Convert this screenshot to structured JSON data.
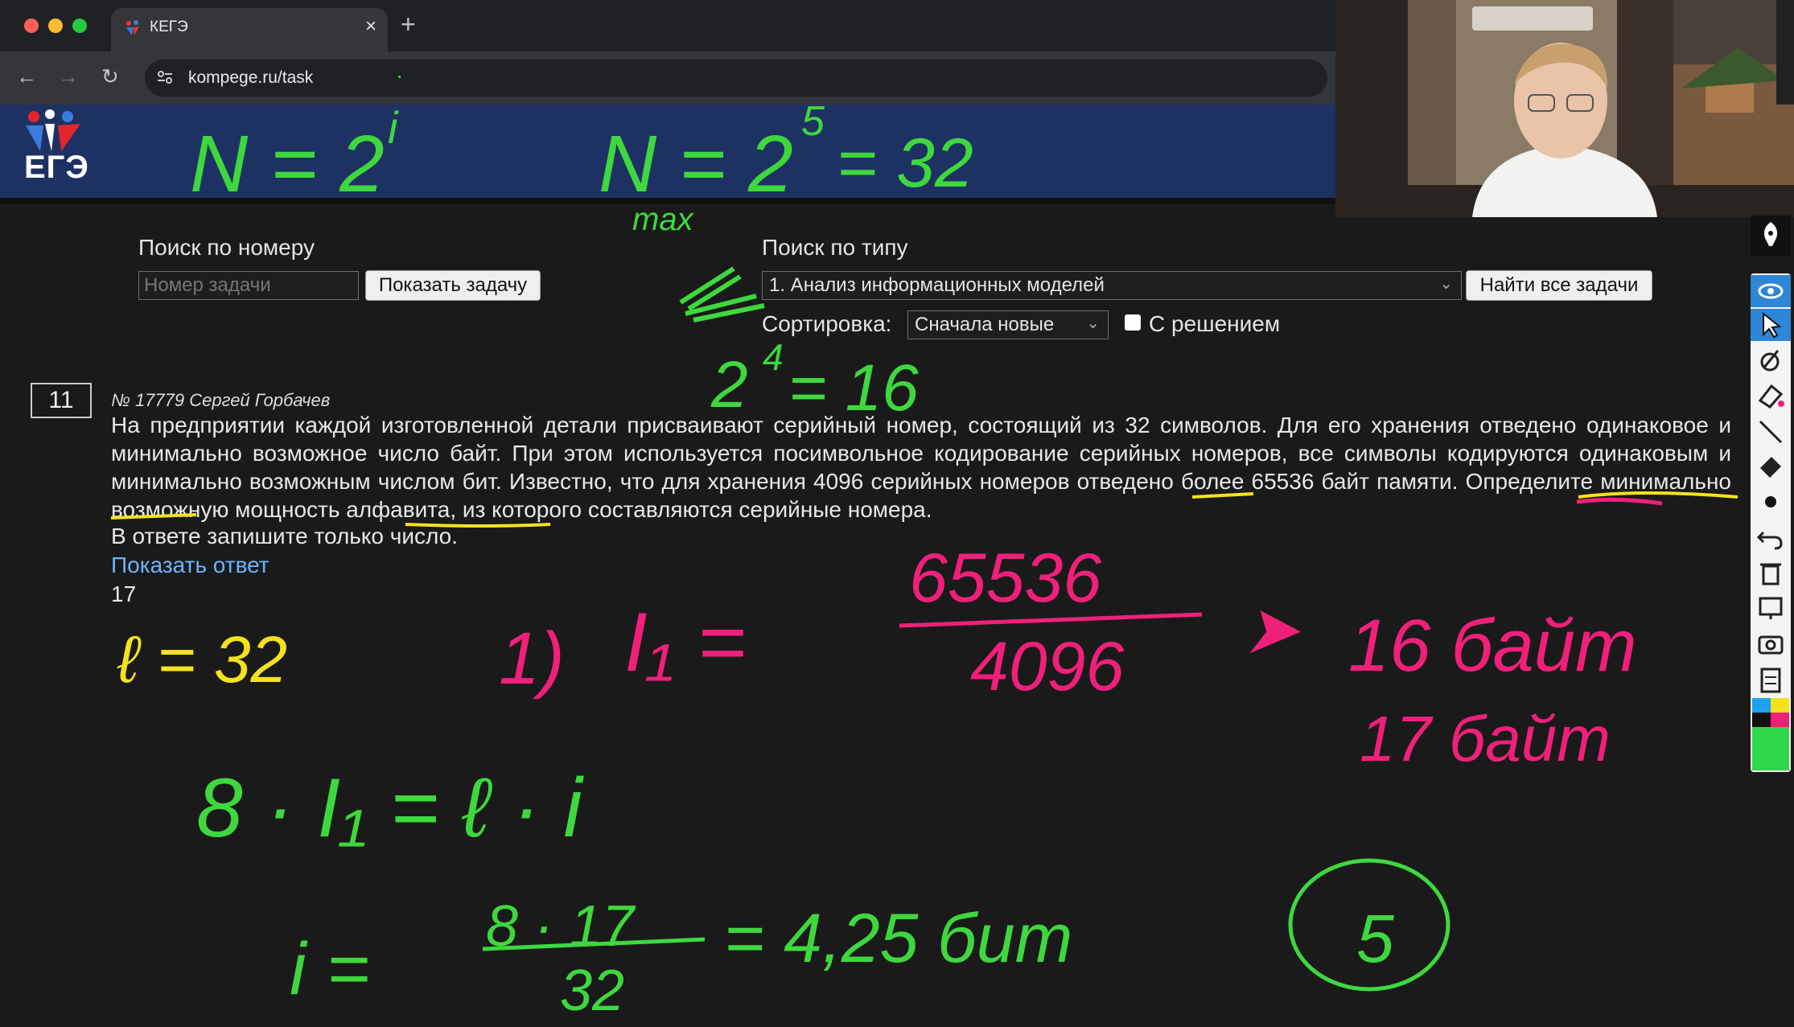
{
  "browser": {
    "tab_title": "КЕГЭ",
    "tab_close": "×",
    "new_tab": "+",
    "back": "←",
    "forward": "→",
    "reload": "↻",
    "url": "kompege.ru/task",
    "url_dot": "·"
  },
  "site": {
    "logo_text": "ЕГЭ"
  },
  "search_by_number": {
    "label": "Поиск по номеру",
    "placeholder": "Номер задачи",
    "button": "Показать задачу"
  },
  "search_by_type": {
    "label": "Поиск по типу",
    "selected_type": "1. Анализ информационных моделей",
    "button": "Найти все задачи",
    "sort_label": "Сортировка:",
    "sort_value": "Сначала новые",
    "solution_checkbox_label": "С решением",
    "solution_checked": false
  },
  "task": {
    "number": "11",
    "meta": "№ 17779 Сергей Горбачев",
    "text": "На предприятии каждой изготовленной детали присваивают серийный номер, состоящий из 32 символов. Для его хранения отведено одинаковое и минимально возможное число байт. При этом используется посимвольное кодирование серийных номеров, все символы кодируются одинаковым и минимально возможным числом бит. Известно, что для хранения 4096 серийных номеров отведено более 65536 байт памяти. Определите минимально возможную мощность алфавита, из которого составляются серийные номера.",
    "instruction": "В ответе запишите только число.",
    "show_answer": "Показать ответ",
    "answer": "17"
  },
  "handwriting": {
    "formula1": "N = 2",
    "formula1_exp": "i",
    "formula2": "N = 2",
    "formula2_exp": "5",
    "formula2_rhs": "= 32",
    "max": "max",
    "pow16": "2",
    "pow16_exp": "4",
    "pow16_rhs": "= 16",
    "l32": "ℓ = 32",
    "step1": "1)",
    "I1": "I₁ =",
    "numerator": "65536",
    "denominator": "4096",
    "arrow": "➤",
    "res16": "16 байт",
    "res17": "17 байт",
    "eq2": "8 · I₁ = ℓ · i",
    "eq3_lhs": "i =",
    "eq3_num": "8 · 17",
    "eq3_den": "32",
    "eq3_rhs": "= 4,25 бит",
    "final": "5"
  },
  "colors": {
    "green": "#3ed83e",
    "pink": "#f0207a",
    "yellow": "#f5e21e",
    "header_blue": "#1d3263",
    "link": "#6cb4ff",
    "tool_active": "#2d86d6"
  },
  "annotation_tools": [
    "pen-icon",
    "eye-icon",
    "pointer-icon",
    "eraser-icon",
    "highlighter-icon",
    "line-icon",
    "marker-icon",
    "dot-icon",
    "undo-icon",
    "trash-icon",
    "screen-icon",
    "camera-icon",
    "clipboard-icon",
    "palette-icon"
  ]
}
